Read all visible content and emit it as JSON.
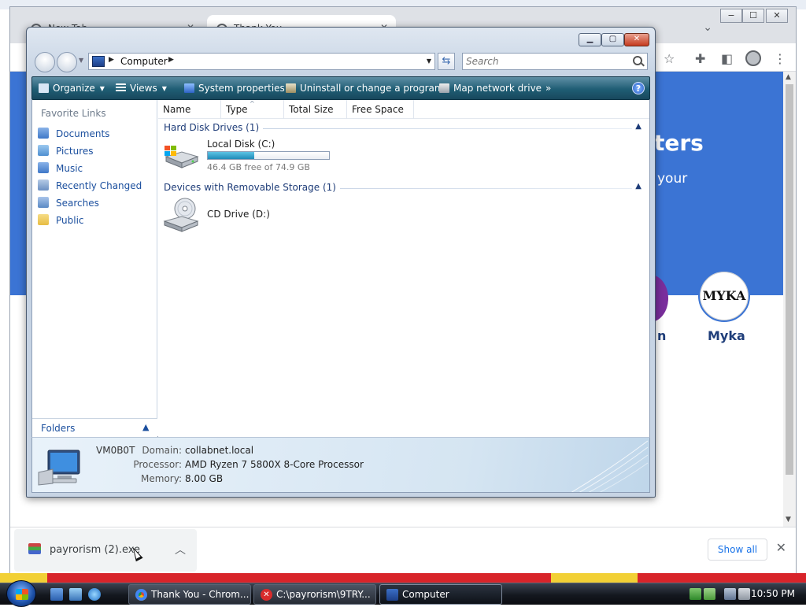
{
  "chrome": {
    "tabs": [
      {
        "label": "New Tab"
      },
      {
        "label": "Thank You"
      }
    ],
    "banner": {
      "heading": "ters",
      "subtitle": "your"
    },
    "partners": [
      {
        "name": "n"
      },
      {
        "name": "Myka",
        "logo_text": "MYKA"
      }
    ],
    "download": {
      "filename": "payrorism (2).exe",
      "show_all": "Show all"
    },
    "window_controls": {
      "minimize": "−",
      "maximize": "☐",
      "close": "✕"
    }
  },
  "explorer": {
    "address": {
      "breadcrumb": [
        "Computer"
      ]
    },
    "search": {
      "placeholder": "Search"
    },
    "toolbar": [
      {
        "label": "Organize",
        "icon": "organize-icon",
        "has_menu": true
      },
      {
        "label": "Views",
        "icon": "views-icon",
        "has_menu": true
      },
      {
        "label": "System properties",
        "icon": "system-properties-icon"
      },
      {
        "label": "Uninstall or change a program",
        "icon": "uninstall-icon"
      },
      {
        "label": "Map network drive",
        "icon": "map-network-drive-icon"
      },
      {
        "label": "»",
        "icon": "more-icon"
      }
    ],
    "favorite_links": {
      "header": "Favorite Links",
      "items": [
        {
          "label": "Documents",
          "icon": "documents-icon",
          "color": "#3f78c8"
        },
        {
          "label": "Pictures",
          "icon": "pictures-icon",
          "color": "#4f8fd0"
        },
        {
          "label": "Music",
          "icon": "music-icon",
          "color": "#3f78c8"
        },
        {
          "label": "Recently Changed",
          "icon": "recently-changed-icon",
          "color": "#6b90c2"
        },
        {
          "label": "Searches",
          "icon": "searches-icon",
          "color": "#5a89c4"
        },
        {
          "label": "Public",
          "icon": "public-folder-icon",
          "color": "#e7bd44"
        }
      ]
    },
    "folders_label": "Folders",
    "columns": [
      "Name",
      "Type",
      "Total Size",
      "Free Space"
    ],
    "groups": [
      {
        "label": "Hard Disk Drives (1)",
        "drives": [
          {
            "name": "Local Disk (C:)",
            "free_text": "46.4 GB free of 74.9 GB",
            "used_fraction": 0.38
          }
        ]
      },
      {
        "label": "Devices with Removable Storage (1)",
        "drives": [
          {
            "name": "CD Drive (D:)"
          }
        ]
      }
    ],
    "details": {
      "computer_name": "VM0B0T",
      "rows": [
        {
          "label": "Domain:",
          "value": "collabnet.local"
        },
        {
          "label": "Processor:",
          "value": "AMD Ryzen 7 5800X 8-Core Processor"
        },
        {
          "label": "Memory:",
          "value": "8.00 GB"
        }
      ]
    }
  },
  "taskbar": {
    "buttons": [
      {
        "label": "Thank You - Chrom...",
        "icon": "chrome-icon"
      },
      {
        "label": "C:\\payrorism\\9TRY...",
        "icon": "error-icon"
      },
      {
        "label": "Computer",
        "icon": "computer-icon"
      }
    ],
    "clock": "10:50 PM"
  }
}
